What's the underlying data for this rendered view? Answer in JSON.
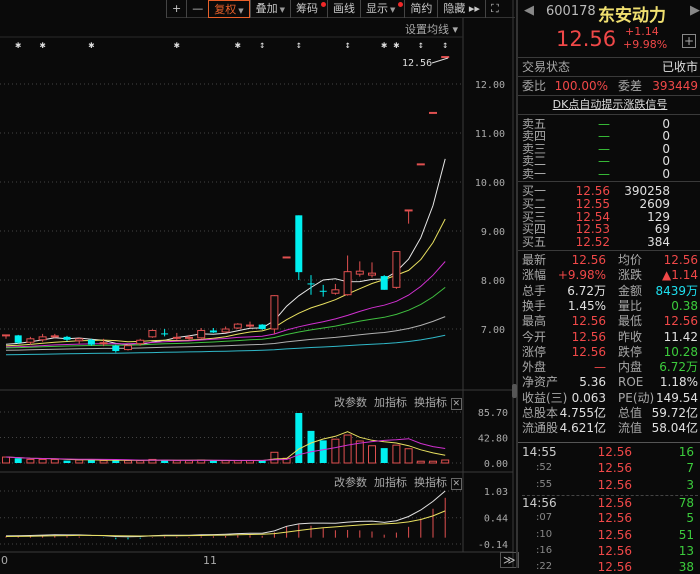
{
  "toolbar": {
    "zoom_in": "+",
    "zoom_out": "—",
    "restore_rights": "复权",
    "overlay": "叠加",
    "chips": "筹码",
    "draw": "画线",
    "display": "显示",
    "simple": "简约",
    "hide": "隐藏 ▸▸",
    "fullscreen": "⛶"
  },
  "chart": {
    "ma_setting": "设置均线 ▾",
    "last_price_label": "12.56",
    "price_ticks": [
      "12.00",
      "11.00",
      "10.00",
      "9.00",
      "8.00",
      "7.00"
    ],
    "price_tick_values": [
      12,
      11,
      10,
      9,
      8,
      7
    ],
    "volume_ticks": [
      "85.70",
      "42.80",
      "0.00"
    ],
    "macd_ticks": [
      "1.03",
      "0.44",
      "-0.14"
    ],
    "panel_buttons": {
      "params": "改参数",
      "add": "加指标",
      "switch": "换指标",
      "close": "✕"
    },
    "date_labels": [
      "0",
      "11"
    ],
    "scroll_button": "≫",
    "markers": [
      {
        "x_index": 1,
        "type": "star"
      },
      {
        "x_index": 3,
        "type": "star"
      },
      {
        "x_index": 7,
        "type": "star"
      },
      {
        "x_index": 14,
        "type": "star"
      },
      {
        "x_index": 19,
        "type": "star"
      },
      {
        "x_index": 21,
        "type": "arrow"
      },
      {
        "x_index": 24,
        "type": "arrow"
      },
      {
        "x_index": 28,
        "type": "arrow"
      },
      {
        "x_index": 31,
        "type": "star"
      },
      {
        "x_index": 32,
        "type": "star"
      },
      {
        "x_index": 34,
        "type": "arrow"
      },
      {
        "x_index": 36,
        "type": "arrow"
      }
    ],
    "ma_colors": [
      "#e8e8e8",
      "#e8e060",
      "#d030d0",
      "#40c040",
      "#b0b0b0",
      "#30b8c8"
    ],
    "up_color": "#e05050",
    "down_color": "#00f0f0"
  },
  "chart_data": {
    "type": "candlestick",
    "candles": [
      [
        6.88,
        6.88,
        6.8,
        6.88,
        10
      ],
      [
        6.87,
        6.88,
        6.7,
        6.72,
        8
      ],
      [
        6.73,
        6.84,
        6.68,
        6.8,
        6
      ],
      [
        6.78,
        6.9,
        6.74,
        6.84,
        6
      ],
      [
        6.85,
        6.9,
        6.82,
        6.86,
        6
      ],
      [
        6.84,
        6.86,
        6.75,
        6.78,
        4
      ],
      [
        6.76,
        6.82,
        6.7,
        6.8,
        5
      ],
      [
        6.78,
        6.8,
        6.66,
        6.68,
        5
      ],
      [
        6.71,
        6.8,
        6.65,
        6.72,
        4
      ],
      [
        6.66,
        6.68,
        6.52,
        6.55,
        5
      ],
      [
        6.58,
        6.68,
        6.56,
        6.66,
        4
      ],
      [
        6.7,
        6.8,
        6.66,
        6.77,
        4
      ],
      [
        6.84,
        6.99,
        6.82,
        6.97,
        6
      ],
      [
        6.91,
        7.0,
        6.85,
        6.9,
        5
      ],
      [
        6.82,
        6.92,
        6.78,
        6.83,
        4
      ],
      [
        6.82,
        6.88,
        6.78,
        6.83,
        4
      ],
      [
        6.82,
        7.02,
        6.8,
        6.97,
        5
      ],
      [
        6.97,
        7.02,
        6.92,
        6.93,
        4
      ],
      [
        6.94,
        7.05,
        6.92,
        7.0,
        4
      ],
      [
        7.02,
        7.12,
        7.0,
        7.1,
        4
      ],
      [
        7.08,
        7.15,
        7.02,
        7.08,
        4
      ],
      [
        7.09,
        7.1,
        6.98,
        7.0,
        4
      ],
      [
        7.0,
        7.69,
        6.9,
        7.68,
        18
      ],
      [
        8.47,
        8.47,
        8.47,
        8.47,
        8
      ],
      [
        9.32,
        9.32,
        8.0,
        8.16,
        84
      ],
      [
        7.93,
        8.1,
        7.7,
        7.92,
        54
      ],
      [
        7.78,
        7.9,
        7.66,
        7.77,
        38
      ],
      [
        7.73,
        7.92,
        7.7,
        7.8,
        40
      ],
      [
        7.7,
        8.5,
        7.68,
        8.17,
        47
      ],
      [
        8.12,
        8.38,
        8.07,
        8.18,
        37
      ],
      [
        8.1,
        8.36,
        8.05,
        8.14,
        29
      ],
      [
        8.08,
        8.1,
        7.8,
        7.8,
        25
      ],
      [
        7.85,
        8.58,
        7.82,
        8.58,
        30
      ],
      [
        9.43,
        9.43,
        9.15,
        9.43,
        24
      ],
      [
        10.37,
        10.37,
        10.37,
        10.37,
        3
      ],
      [
        11.42,
        11.42,
        11.42,
        11.42,
        3
      ],
      [
        12.56,
        12.56,
        12.56,
        12.56,
        5
      ]
    ],
    "columns": [
      "open",
      "high",
      "low",
      "close",
      "volume"
    ],
    "ma_periods": [
      5,
      10,
      20,
      30,
      60,
      120
    ],
    "prior_close_level": 6.65,
    "ylim": [
      6.2,
      12.9
    ],
    "volume_ylim": [
      0,
      85.7
    ],
    "macd_ylim": [
      -0.14,
      1.03
    ]
  },
  "quote": {
    "code": "600178",
    "name": "东安动力",
    "price": "12.56",
    "change": "+1.14",
    "change_pct": "+9.98%",
    "status_label": "交易状态",
    "status_value": "已收市",
    "ratio_label": "委比",
    "ratio_value": "100.00%",
    "diff_label": "委差",
    "diff_value": "393449",
    "signal_link": "DK点自动提示涨跌信号",
    "asks": [
      {
        "label": "卖五",
        "price": "—",
        "vol": "0"
      },
      {
        "label": "卖四",
        "price": "—",
        "vol": "0"
      },
      {
        "label": "卖三",
        "price": "—",
        "vol": "0"
      },
      {
        "label": "卖二",
        "price": "—",
        "vol": "0"
      },
      {
        "label": "卖一",
        "price": "—",
        "vol": "0"
      }
    ],
    "bids": [
      {
        "label": "买一",
        "price": "12.56",
        "vol": "390258"
      },
      {
        "label": "买二",
        "price": "12.55",
        "vol": "2609"
      },
      {
        "label": "买三",
        "price": "12.54",
        "vol": "129"
      },
      {
        "label": "买四",
        "price": "12.53",
        "vol": "69"
      },
      {
        "label": "买五",
        "price": "12.52",
        "vol": "384"
      }
    ],
    "stats": [
      {
        "l1": "最新",
        "v1": "12.56",
        "c1": "red",
        "l2": "均价",
        "v2": "12.56",
        "c2": "red"
      },
      {
        "l1": "涨幅",
        "v1": "+9.98%",
        "c1": "red",
        "l2": "涨跌",
        "v2": "▲1.14",
        "c2": "red"
      },
      {
        "l1": "总手",
        "v1": "6.72万",
        "c1": "wht",
        "l2": "金额",
        "v2": "8439万",
        "c2": "cyn"
      },
      {
        "l1": "换手",
        "v1": "1.45%",
        "c1": "wht",
        "l2": "量比",
        "v2": "0.38",
        "c2": "grn"
      },
      {
        "l1": "最高",
        "v1": "12.56",
        "c1": "red",
        "l2": "最低",
        "v2": "12.56",
        "c2": "red"
      },
      {
        "l1": "今开",
        "v1": "12.56",
        "c1": "red",
        "l2": "昨收",
        "v2": "11.42",
        "c2": "wht"
      },
      {
        "l1": "涨停",
        "v1": "12.56",
        "c1": "red",
        "l2": "跌停",
        "v2": "10.28",
        "c2": "grn"
      },
      {
        "l1": "外盘",
        "v1": "—",
        "c1": "red",
        "l2": "内盘",
        "v2": "6.72万",
        "c2": "grn"
      },
      {
        "l1": "净资产",
        "v1": "5.36",
        "c1": "wht",
        "l2": "ROE",
        "v2": "1.18%",
        "c2": "wht"
      },
      {
        "l1": "收益(三)",
        "v1": "0.063",
        "c1": "wht",
        "l2": "PE(动)",
        "v2": "149.54",
        "c2": "wht"
      },
      {
        "l1": "总股本",
        "v1": "4.755亿",
        "c1": "wht",
        "l2": "总值",
        "v2": "59.72亿",
        "c2": "wht"
      },
      {
        "l1": "流通股",
        "v1": "4.621亿",
        "c1": "wht",
        "l2": "流值",
        "v2": "58.04亿",
        "c2": "wht"
      }
    ],
    "ticks": [
      {
        "time": "14:55",
        "price": "12.56",
        "vol": "16"
      },
      {
        "time": ":52",
        "price": "12.56",
        "vol": "7"
      },
      {
        "time": ":55",
        "price": "12.56",
        "vol": "3"
      },
      {
        "time": "14:56",
        "price": "12.56",
        "vol": "78"
      },
      {
        "time": ":07",
        "price": "12.56",
        "vol": "5"
      },
      {
        "time": ":10",
        "price": "12.56",
        "vol": "51"
      },
      {
        "time": ":16",
        "price": "12.56",
        "vol": "13"
      },
      {
        "time": ":22",
        "price": "12.56",
        "vol": "38"
      }
    ]
  }
}
